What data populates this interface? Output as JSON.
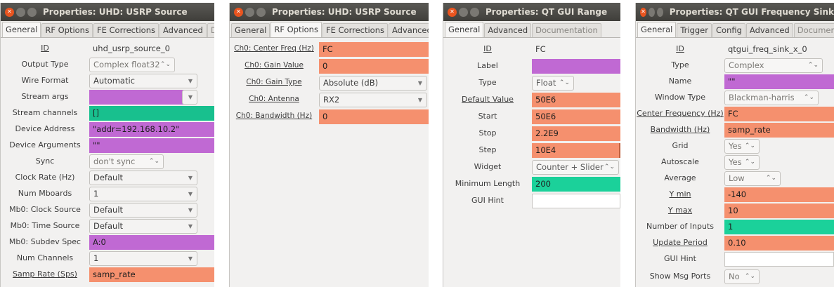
{
  "colors": {
    "orange": "#f5906e",
    "purple": "#c069d3",
    "green": "#1bd19a",
    "titlebar": "#3f3e3a",
    "close": "#e9541f"
  },
  "windows": [
    {
      "title": "Properties: UHD: USRP Source",
      "tabs": [
        "General",
        "RF Options",
        "FE Corrections",
        "Advanced",
        "Doc"
      ],
      "active_tab": "General",
      "rows": [
        {
          "label": "ID",
          "value": "uhd_usrp_source_0",
          "kind": "plain"
        },
        {
          "label": "Output Type",
          "value": "Complex float32",
          "kind": "spin"
        },
        {
          "label": "Wire Format",
          "value": "Automatic",
          "kind": "combo"
        },
        {
          "label": "Stream args",
          "value": "",
          "kind": "purple-combo"
        },
        {
          "label": "Stream channels",
          "value": "[]",
          "kind": "green"
        },
        {
          "label": "Device Address",
          "value": "\"addr=192.168.10.2\"",
          "kind": "purple"
        },
        {
          "label": "Device Arguments",
          "value": "\"\"",
          "kind": "purple"
        },
        {
          "label": "Sync",
          "value": "don't sync",
          "kind": "spin"
        },
        {
          "label": "Clock Rate (Hz)",
          "value": "Default",
          "kind": "combo"
        },
        {
          "label": "Num Mboards",
          "value": "1",
          "kind": "combo"
        },
        {
          "label": "Mb0: Clock Source",
          "value": "Default",
          "kind": "combo"
        },
        {
          "label": "Mb0: Time Source",
          "value": "Default",
          "kind": "combo"
        },
        {
          "label": "Mb0: Subdev Spec",
          "value": "A:0",
          "kind": "purple"
        },
        {
          "label": "Num Channels",
          "value": "1",
          "kind": "combo"
        },
        {
          "label": "Samp Rate (Sps)",
          "value": "samp_rate",
          "kind": "orange"
        }
      ]
    },
    {
      "title": "Properties: UHD: USRP Source",
      "tabs": [
        "General",
        "RF Options",
        "FE Corrections",
        "Advanced"
      ],
      "active_tab": "RF Options",
      "rows": [
        {
          "label": "Ch0: Center Freq (Hz)",
          "value": "FC",
          "kind": "orange"
        },
        {
          "label": "Ch0: Gain Value",
          "value": "0",
          "kind": "orange"
        },
        {
          "label": "Ch0: Gain Type",
          "value": "Absolute (dB)",
          "kind": "combo"
        },
        {
          "label": "Ch0: Antenna",
          "value": "RX2",
          "kind": "combo"
        },
        {
          "label": "Ch0: Bandwidth (Hz)",
          "value": "0",
          "kind": "orange"
        }
      ]
    },
    {
      "title": "Properties: QT GUI Range",
      "tabs": [
        "General",
        "Advanced",
        "Documentation"
      ],
      "active_tab": "General",
      "rows": [
        {
          "label": "ID",
          "value": "FC",
          "kind": "plain"
        },
        {
          "label": "Label",
          "value": "",
          "kind": "purple"
        },
        {
          "label": "Type",
          "value": "Float",
          "kind": "spin"
        },
        {
          "label": "Default Value",
          "value": "50E6",
          "kind": "orange"
        },
        {
          "label": "Start",
          "value": "50E6",
          "kind": "orange"
        },
        {
          "label": "Stop",
          "value": "2.2E9",
          "kind": "orange"
        },
        {
          "label": "Step",
          "value": "10E4",
          "kind": "orange"
        },
        {
          "label": "Widget",
          "value": "Counter + Slider",
          "kind": "spin"
        },
        {
          "label": "Minimum Length",
          "value": "200",
          "kind": "green"
        },
        {
          "label": "GUI Hint",
          "value": "",
          "kind": "white"
        }
      ]
    },
    {
      "title": "Properties: QT GUI Frequency Sink",
      "tabs": [
        "General",
        "Trigger",
        "Config",
        "Advanced",
        "Document"
      ],
      "active_tab": "General",
      "rows": [
        {
          "label": "ID",
          "value": "qtgui_freq_sink_x_0",
          "kind": "plain"
        },
        {
          "label": "Type",
          "value": "Complex",
          "kind": "spin"
        },
        {
          "label": "Name",
          "value": "\"\"",
          "kind": "purple"
        },
        {
          "label": "Window Type",
          "value": "Blackman-harris",
          "kind": "spin"
        },
        {
          "label": "Center Frequency (Hz)",
          "value": "FC",
          "kind": "orange"
        },
        {
          "label": "Bandwidth (Hz)",
          "value": "samp_rate",
          "kind": "orange"
        },
        {
          "label": "Grid",
          "value": "Yes",
          "kind": "spin"
        },
        {
          "label": "Autoscale",
          "value": "Yes",
          "kind": "spin"
        },
        {
          "label": "Average",
          "value": "Low",
          "kind": "spin"
        },
        {
          "label": "Y min",
          "value": "-140",
          "kind": "orange"
        },
        {
          "label": "Y max",
          "value": "10",
          "kind": "orange"
        },
        {
          "label": "Number of Inputs",
          "value": "1",
          "kind": "green"
        },
        {
          "label": "Update Period",
          "value": "0.10",
          "kind": "orange"
        },
        {
          "label": "GUI Hint",
          "value": "",
          "kind": "white"
        },
        {
          "label": "Show Msg Ports",
          "value": "No",
          "kind": "spin"
        }
      ]
    }
  ]
}
